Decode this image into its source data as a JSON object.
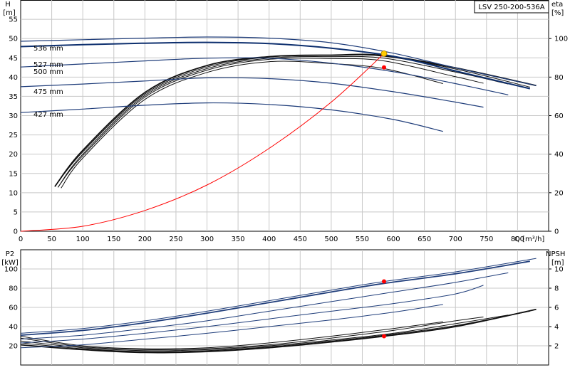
{
  "chart_data": [
    {
      "type": "line",
      "panel": "head-efficiency",
      "title": "LSV 250-200-536A",
      "xlabel": "Q [m³/h]",
      "ylabel_left": [
        "H",
        "[m]"
      ],
      "ylabel_right": [
        "eta",
        "[%]"
      ],
      "xlim": [
        0,
        850
      ],
      "ylim_left": [
        0,
        60
      ],
      "ylim_right": [
        0,
        120
      ],
      "x_ticks": [
        "0",
        "50",
        "100",
        "150",
        "200",
        "250",
        "300",
        "350",
        "400",
        "450",
        "500",
        "550",
        "600",
        "650",
        "700",
        "750",
        "800"
      ],
      "y_ticks_left": [
        "0",
        "5",
        "10",
        "15",
        "20",
        "25",
        "30",
        "35",
        "40",
        "45",
        "50",
        "55"
      ],
      "y_ticks_right": [
        "0",
        "20",
        "40",
        "60",
        "80",
        "100"
      ],
      "grid": true,
      "head_curves": [
        {
          "name": "536 mm",
          "color": "#1f3d7a",
          "x": [
            0,
            100,
            200,
            300,
            400,
            500,
            600,
            700,
            830
          ],
          "y": [
            49.3,
            49.7,
            50.1,
            50.4,
            50.1,
            48.9,
            46.2,
            42.4,
            37.8
          ]
        },
        {
          "name": "527 mm",
          "color": "#0d2f6e",
          "x": [
            0,
            100,
            200,
            300,
            400,
            500,
            600,
            700,
            820
          ],
          "y": [
            47.9,
            48.4,
            48.8,
            49.0,
            48.7,
            47.5,
            45.4,
            41.6,
            37.0
          ]
        },
        {
          "name": "500 mm",
          "color": "#1f3d7a",
          "x": [
            0,
            100,
            200,
            300,
            400,
            500,
            600,
            700,
            785
          ],
          "y": [
            42.6,
            43.4,
            44.2,
            44.9,
            44.9,
            43.6,
            41.4,
            38.3,
            35.4
          ]
        },
        {
          "name": "475 mm",
          "color": "#1f3d7a",
          "x": [
            0,
            100,
            200,
            300,
            400,
            500,
            600,
            700,
            745
          ],
          "y": [
            37.5,
            38.2,
            39.0,
            39.8,
            39.6,
            38.4,
            36.2,
            33.5,
            32.2
          ]
        },
        {
          "name": "427 mm",
          "color": "#1f3d7a",
          "x": [
            0,
            100,
            200,
            300,
            400,
            500,
            600,
            680
          ],
          "y": [
            30.8,
            31.7,
            32.7,
            33.3,
            32.9,
            31.5,
            29.0,
            25.9
          ]
        }
      ],
      "efficiency_curves": [
        {
          "x": [
            55,
            100,
            200,
            300,
            400,
            500,
            585,
            700,
            830
          ],
          "y": [
            11.6,
            21,
            36,
            43,
            45.3,
            45.7,
            45.6,
            42.4,
            37.8
          ]
        },
        {
          "x": [
            55,
            100,
            200,
            300,
            400,
            500,
            585,
            700,
            820
          ],
          "y": [
            11.6,
            20.6,
            35.6,
            42.6,
            45.2,
            45.6,
            45.4,
            42.1,
            37.4
          ]
        },
        {
          "x": [
            60,
            100,
            200,
            300,
            400,
            500,
            585,
            700,
            785
          ],
          "y": [
            11.4,
            20,
            35.2,
            42.2,
            44.9,
            45.3,
            44.9,
            41.3,
            38.2
          ]
        },
        {
          "x": [
            60,
            100,
            200,
            300,
            400,
            500,
            585,
            700,
            745
          ],
          "y": [
            11.4,
            19.6,
            34.8,
            41.8,
            44.6,
            44.8,
            44.2,
            40.1,
            38.4
          ]
        },
        {
          "x": [
            65,
            100,
            200,
            300,
            400,
            500,
            585,
            680
          ],
          "y": [
            11.2,
            19,
            34.2,
            41.2,
            44.0,
            43.5,
            42.2,
            38.3
          ]
        }
      ],
      "system_curve": {
        "color": "#ff0000",
        "x": [
          0,
          100,
          200,
          300,
          400,
          500,
          585
        ],
        "y": [
          0,
          1.3,
          5.4,
          12.0,
          21.5,
          33.5,
          46.1
        ]
      },
      "operating_point": {
        "x": 585,
        "y": 46.1,
        "color": "#ffcc00"
      },
      "efficiency_point": {
        "x": 585,
        "y": 42.5,
        "color": "#ff0000"
      }
    },
    {
      "type": "line",
      "panel": "power-npsh",
      "xlabel": "",
      "ylabel_left": [
        "P2",
        "[kW]"
      ],
      "ylabel_right": [
        "NPSH",
        "[m]"
      ],
      "xlim": [
        0,
        850
      ],
      "ylim_left": [
        0,
        120
      ],
      "ylim_right": [
        0,
        12
      ],
      "y_ticks_left": [
        "20",
        "40",
        "60",
        "80",
        "100"
      ],
      "y_ticks_right": [
        "2",
        "4",
        "6",
        "8",
        "10"
      ],
      "grid": true,
      "power_curves": [
        {
          "color": "#1f3d7a",
          "x": [
            0,
            100,
            200,
            300,
            400,
            500,
            585,
            700,
            830
          ],
          "y": [
            33,
            38,
            46,
            56,
            67,
            78,
            87,
            97,
            111
          ]
        },
        {
          "color": "#1f3d7a",
          "x": [
            0,
            100,
            200,
            300,
            400,
            500,
            585,
            700,
            820
          ],
          "y": [
            31,
            36,
            44,
            54,
            65,
            76,
            85,
            95,
            108
          ]
        },
        {
          "color": "#1f3d7a",
          "x": [
            0,
            100,
            200,
            300,
            400,
            500,
            600,
            700,
            785
          ],
          "y": [
            27,
            31,
            38,
            46,
            56,
            66,
            76,
            86,
            96
          ]
        },
        {
          "color": "#1f3d7a",
          "x": [
            0,
            100,
            200,
            300,
            400,
            500,
            600,
            700,
            745
          ],
          "y": [
            23,
            27,
            33,
            40,
            48,
            56,
            64,
            74,
            83
          ]
        },
        {
          "color": "#1f3d7a",
          "x": [
            0,
            100,
            200,
            300,
            400,
            500,
            600,
            680
          ],
          "y": [
            18,
            21,
            27,
            33,
            40,
            47,
            55,
            63
          ]
        }
      ],
      "npsh_curves": [
        {
          "x": [
            0,
            100,
            200,
            300,
            400,
            500,
            585,
            700,
            830
          ],
          "y": [
            2.1,
            1.6,
            1.3,
            1.4,
            1.8,
            2.4,
            3.0,
            4.0,
            5.8
          ]
        },
        {
          "x": [
            0,
            100,
            200,
            300,
            400,
            500,
            585,
            700,
            820
          ],
          "y": [
            2.3,
            1.7,
            1.4,
            1.5,
            1.9,
            2.5,
            3.1,
            4.1,
            5.6
          ]
        },
        {
          "x": [
            0,
            100,
            200,
            300,
            400,
            500,
            600,
            700,
            785
          ],
          "y": [
            2.5,
            1.8,
            1.5,
            1.6,
            2.0,
            2.6,
            3.3,
            4.3,
            5.2
          ]
        },
        {
          "x": [
            0,
            100,
            200,
            300,
            400,
            500,
            600,
            700,
            745
          ],
          "y": [
            2.8,
            1.9,
            1.6,
            1.7,
            2.1,
            2.8,
            3.6,
            4.6,
            5.0
          ]
        },
        {
          "x": [
            0,
            100,
            200,
            300,
            400,
            500,
            600,
            680
          ],
          "y": [
            3.0,
            2.0,
            1.7,
            1.8,
            2.3,
            3.0,
            3.8,
            4.5
          ]
        }
      ],
      "power_point": {
        "x": 585,
        "y": 87,
        "color": "#ff0000"
      },
      "npsh_point": {
        "x": 585,
        "y": 3.0,
        "color": "#ff0000"
      }
    }
  ]
}
